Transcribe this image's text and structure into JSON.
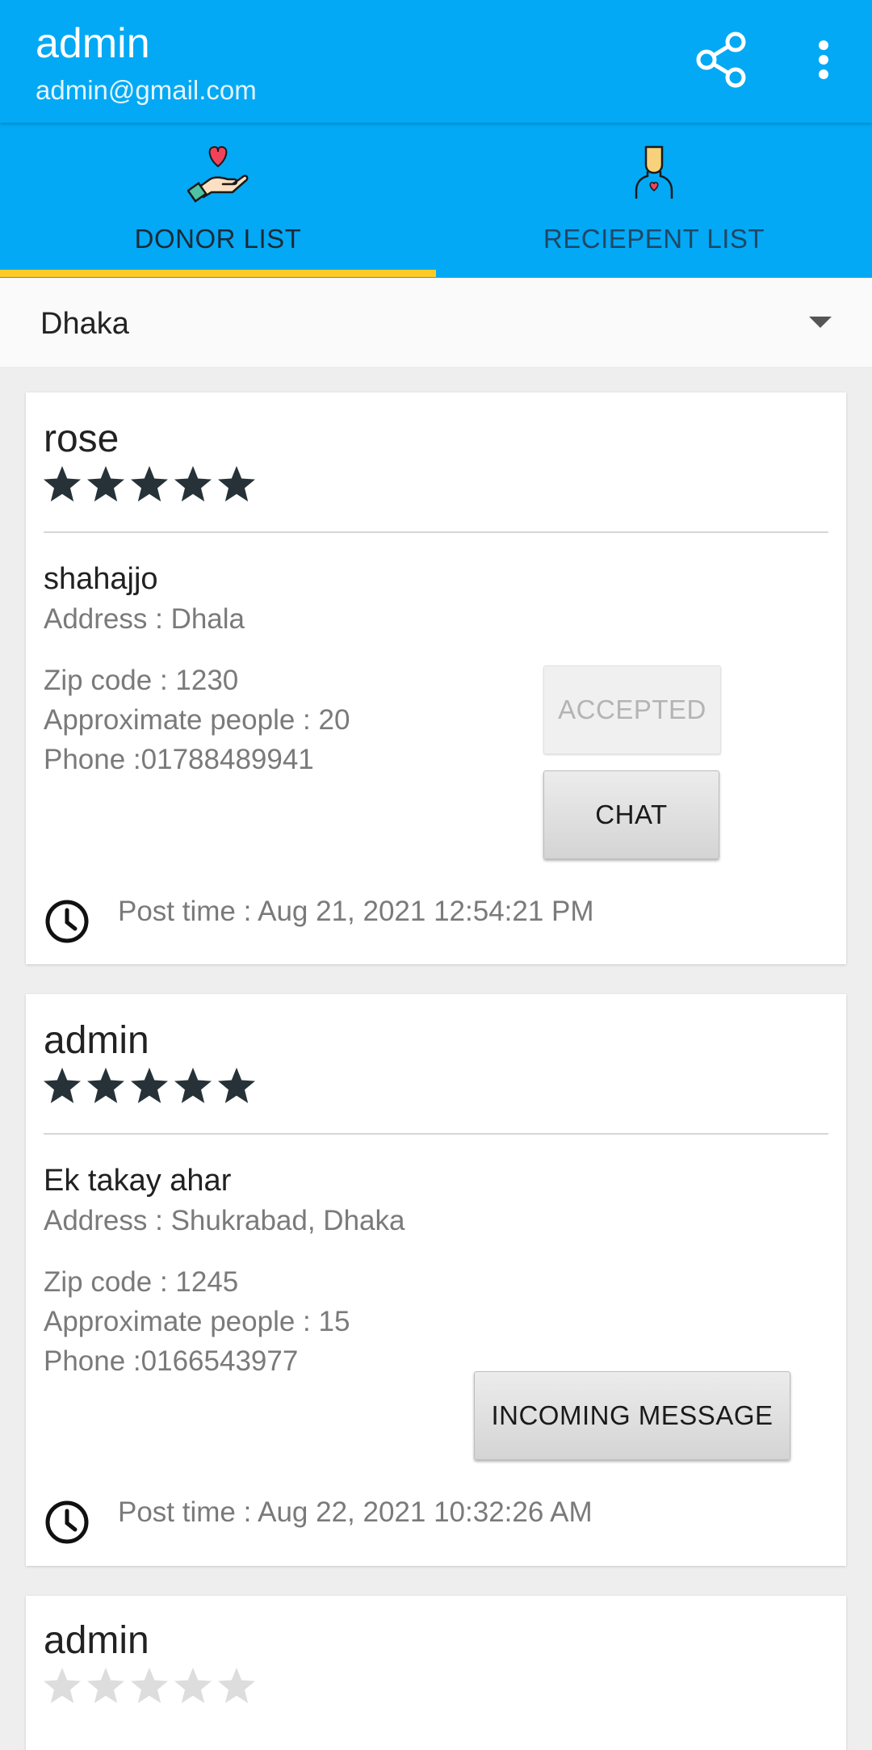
{
  "header": {
    "title": "admin",
    "subtitle": "admin@gmail.com",
    "share_icon": "share-icon",
    "more_icon": "more-vert-icon"
  },
  "tabs": [
    {
      "label": "DONOR LIST",
      "icon": "heart-hand-icon",
      "selected": true
    },
    {
      "label": "RECIEPENT LIST",
      "icon": "recipient-person-icon",
      "selected": false
    }
  ],
  "location": {
    "value": "Dhaka"
  },
  "colors": {
    "primary": "#03a9f4",
    "indicator": "#ffca28",
    "star_filled": "#263238",
    "star_empty": "#dddddd"
  },
  "posts": [
    {
      "name": "rose",
      "rating": 5,
      "org": "shahajjo",
      "address": "Address : Dhala",
      "zip": "Zip code : 1230",
      "people": "Approximate people : 20",
      "phone": "Phone :01788489941",
      "status_button": "ACCEPTED",
      "chat_button": "CHAT",
      "post_time": "Post time : Aug 21, 2021 12:54:21 PM"
    },
    {
      "name": "admin",
      "rating": 5,
      "org": "Ek takay ahar",
      "address": "Address : Shukrabad, Dhaka",
      "zip": "Zip code : 1245",
      "people": "Approximate people : 15",
      "phone": "Phone :0166543977",
      "message_button": "INCOMING MESSAGE",
      "post_time": "Post time : Aug 22, 2021 10:32:26 AM"
    },
    {
      "name": "admin",
      "rating": 0
    }
  ]
}
